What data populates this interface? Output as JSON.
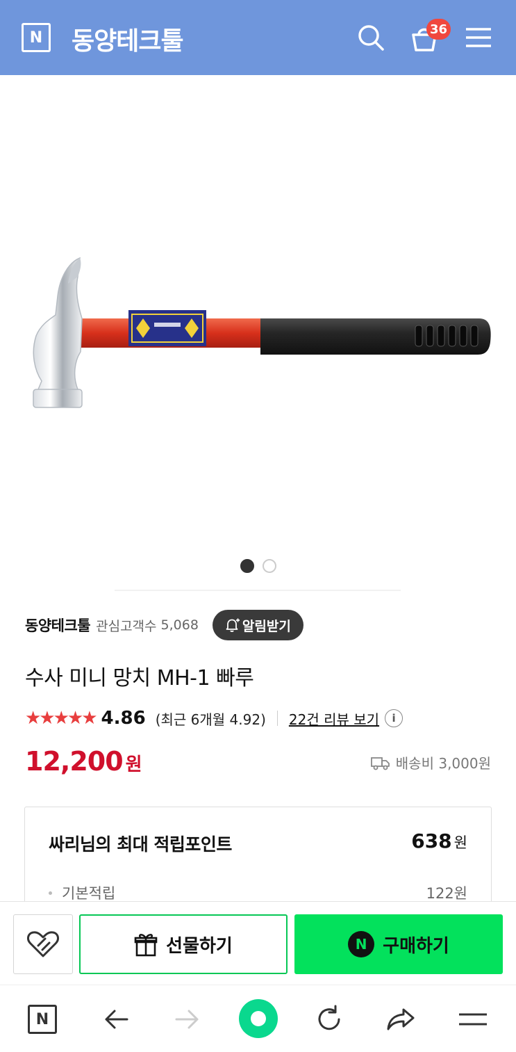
{
  "header": {
    "logo": "N",
    "store_title": "동양테크툴",
    "cart_count": "36",
    "bg_color": "#6f96dc"
  },
  "product": {
    "image_alt_icon": "hammer-image",
    "carousel": {
      "total": 2,
      "active": 1
    },
    "store_name": "동양테크툴",
    "followers_label": "관심고객수",
    "followers_count": "5,068",
    "alert_button": "알림받기",
    "name": "수사 미니 망치 MH-1 빠루",
    "rating": {
      "stars": "★★★★★",
      "value": "4.86",
      "recent": "(최근 6개월 4.92)",
      "review_link": "22건 리뷰 보기",
      "info": "i"
    },
    "price": "12,200",
    "price_unit": "원",
    "shipping": "배송비 3,000원",
    "accent_color": "#d0102c"
  },
  "points": {
    "title": "싸리님의 최대 적립포인트",
    "value": "638",
    "unit": "원",
    "sub_label": "기본적립",
    "sub_value": "122원"
  },
  "actions": {
    "gift": "선물하기",
    "buy": "구매하기",
    "buy_badge": "N",
    "buy_color": "#03e15c"
  },
  "browser_nav": {
    "logo": "N",
    "items": [
      "naver-home-icon",
      "back-arrow-icon",
      "forward-arrow-icon",
      "green-home-icon",
      "refresh-icon",
      "share-icon",
      "menu-icon"
    ]
  }
}
